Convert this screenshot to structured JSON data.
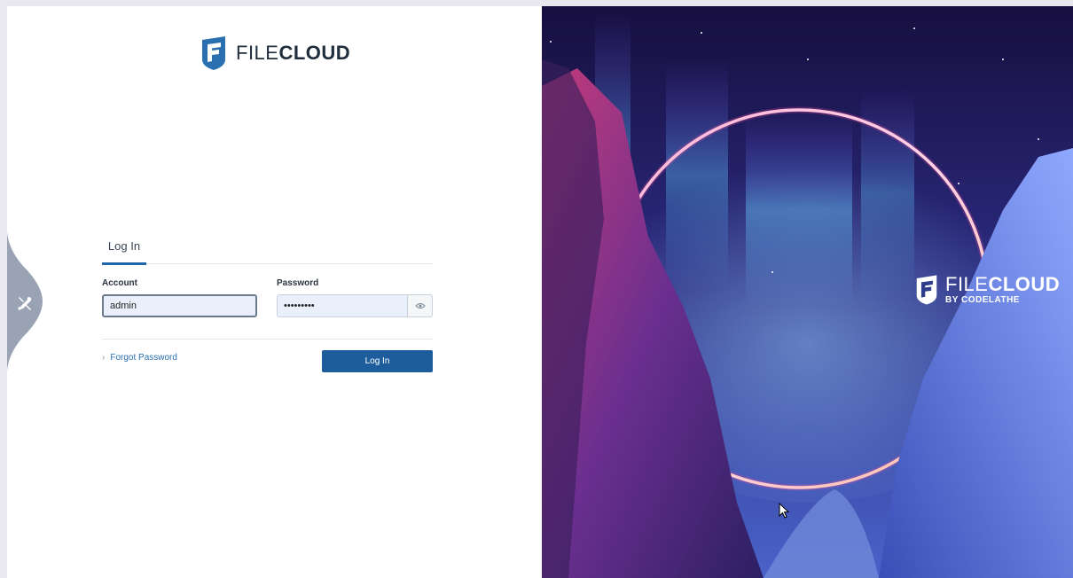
{
  "brand": {
    "name_light": "FILE",
    "name_bold": "CLOUD",
    "tagline": "BY CODELATHE"
  },
  "tabs": {
    "login": "Log In"
  },
  "form": {
    "account_label": "Account",
    "account_value": "admin",
    "password_label": "Password",
    "password_value": "•••••••••",
    "forgot_label": "Forgot Password",
    "submit_label": "Log In"
  },
  "icons": {
    "logo": "filecloud-logo-icon",
    "side_tab": "tools-icon",
    "reveal": "eye-icon",
    "forgot": "chevron-right-icon"
  },
  "colors": {
    "accent": "#1e5d9c",
    "link": "#2a6fb0"
  }
}
